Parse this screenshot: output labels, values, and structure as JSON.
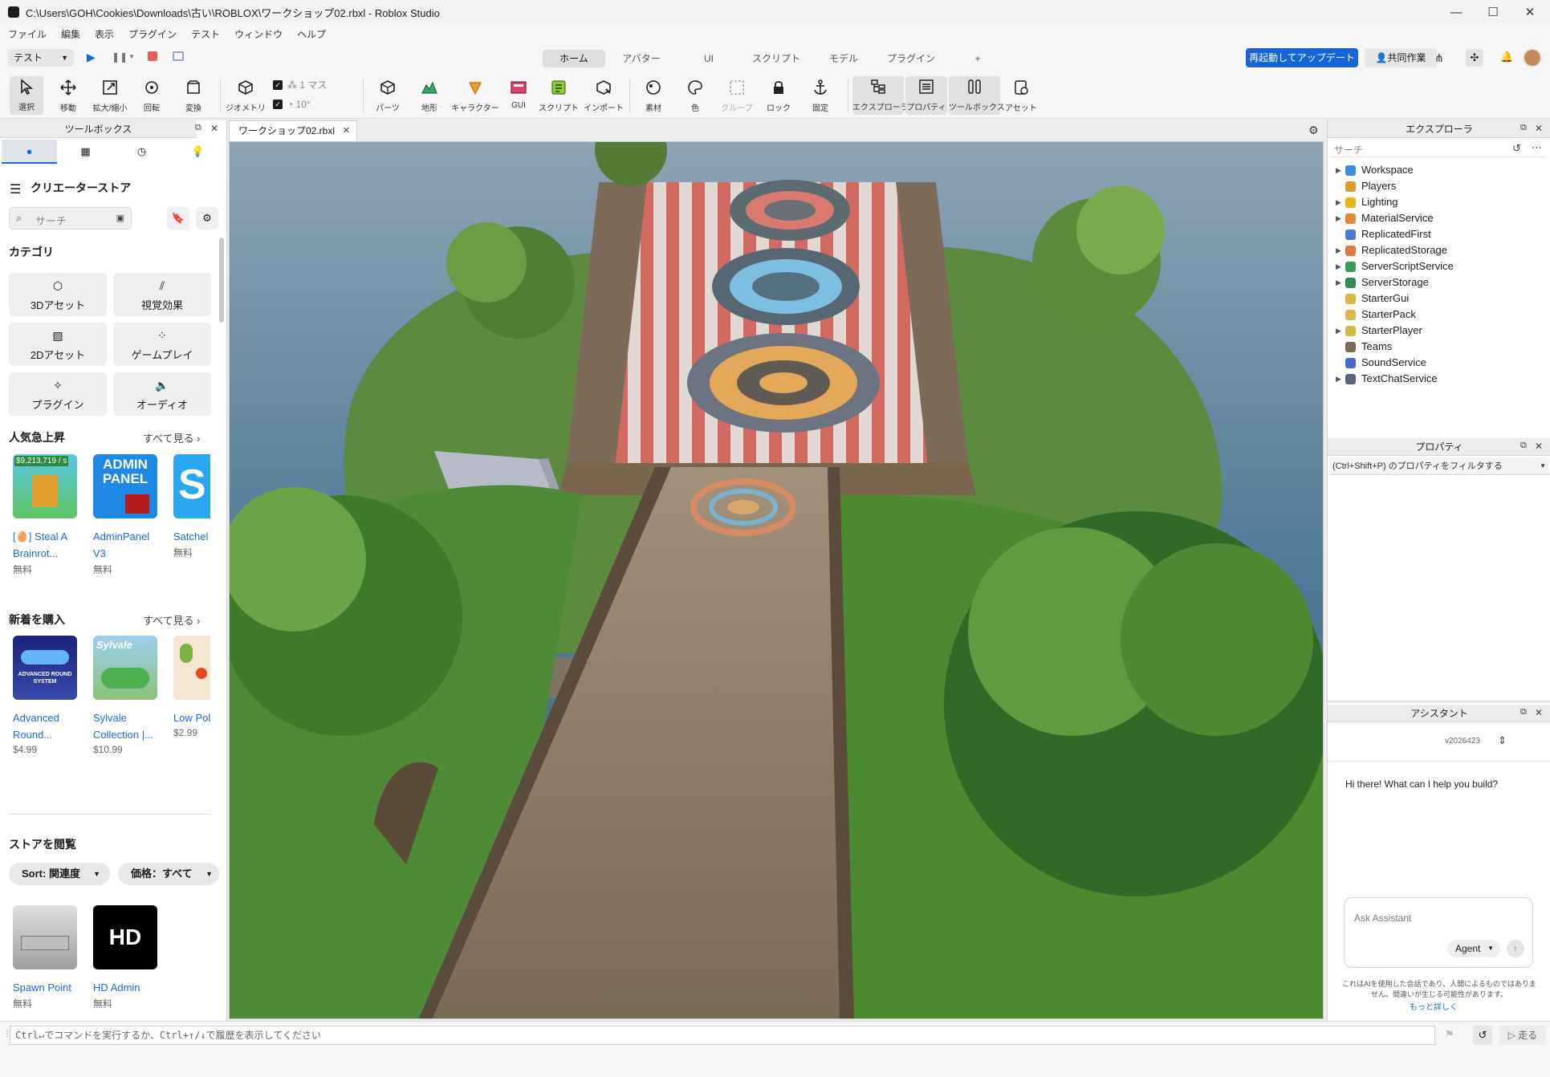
{
  "window": {
    "title": "C:\\Users\\GOH\\Cookies\\Downloads\\古い\\ROBLOX\\ワークショップ02.rbxl - Roblox Studio",
    "minimize": "—",
    "maximize": "☐",
    "close": "✕"
  },
  "menu": [
    "ファイル",
    "編集",
    "表示",
    "プラグイン",
    "テスト",
    "ウィンドウ",
    "ヘルプ"
  ],
  "toolbar_top": {
    "mode_select": "テスト",
    "tabs": [
      "ホーム",
      "アバター",
      "UI",
      "スクリプト",
      "モデル",
      "プラグイン",
      "+"
    ],
    "active_tab": "ホーム",
    "update_button": "再起動してアップデート",
    "collab_button": "共同作業"
  },
  "ribbon": {
    "tools": [
      {
        "label": "選択",
        "icon": "cursor-icon"
      },
      {
        "label": "移動",
        "icon": "move-icon"
      },
      {
        "label": "拡大/縮小",
        "icon": "scale-icon"
      },
      {
        "label": "回転",
        "icon": "rotate-icon"
      },
      {
        "label": "変換",
        "icon": "transform-icon"
      }
    ],
    "geometry_label": "ジオメトリ",
    "snap_move": "1 マス",
    "snap_rotate": "10°",
    "insert": [
      {
        "label": "パーツ",
        "icon": "part-icon"
      },
      {
        "label": "地形",
        "icon": "terrain-icon"
      },
      {
        "label": "キャラクター",
        "icon": "character-icon"
      },
      {
        "label": "GUI",
        "icon": "gui-icon"
      },
      {
        "label": "スクリプト",
        "icon": "script-icon"
      },
      {
        "label": "インポート",
        "icon": "import-icon"
      }
    ],
    "edit": [
      {
        "label": "素材",
        "icon": "material-icon"
      },
      {
        "label": "色",
        "icon": "color-icon"
      },
      {
        "label": "グループ",
        "icon": "group-icon"
      },
      {
        "label": "ロック",
        "icon": "lock-icon"
      },
      {
        "label": "固定",
        "icon": "anchor-icon"
      }
    ],
    "windows": [
      {
        "label": "エクスプローラ",
        "icon": "explorer-icon"
      },
      {
        "label": "プロパティ",
        "icon": "properties-icon"
      },
      {
        "label": "ツールボックス",
        "icon": "toolbox-icon"
      },
      {
        "label": "アセット",
        "icon": "asset-icon"
      }
    ]
  },
  "toolbox": {
    "title": "ツールボックス",
    "store_title": "クリエーターストア",
    "search_placeholder": "サーチ",
    "category_title": "カテゴリ",
    "categories": [
      "3Dアセット",
      "視覚効果",
      "2Dアセット",
      "ゲームプレイ",
      "プラグイン",
      "オーディオ"
    ],
    "trending": {
      "title": "人気急上昇",
      "see_all": "すべて見る ›",
      "items": [
        {
          "name": "[🥚] Steal A Brainrot...",
          "price": "無料",
          "thumb_text": "$9,213,719 / s"
        },
        {
          "name": "AdminPanel V3",
          "price": "無料",
          "thumb_text": "ADMIN PANEL"
        },
        {
          "name": "Satchel",
          "price": "無料",
          "thumb_text": "S"
        }
      ]
    },
    "new": {
      "title": "新着を購入",
      "see_all": "すべて見る ›",
      "items": [
        {
          "name": "Advanced Round...",
          "price": "$4.99",
          "thumb_text": "ADVANCED ROUND SYSTEM"
        },
        {
          "name": "Sylvale Collection |...",
          "price": "$10.99",
          "thumb_text": "Sylvale"
        },
        {
          "name": "Low Poly Nature",
          "price": "$2.99",
          "thumb_text": ""
        }
      ]
    },
    "browse": {
      "title": "ストアを閲覧",
      "sort": "Sort: 関連度",
      "price": "価格：すべて",
      "items": [
        {
          "name": "Spawn Point",
          "price": "無料",
          "thumb_text": ""
        },
        {
          "name": "HD Admin",
          "price": "無料",
          "thumb_text": "HD"
        }
      ]
    }
  },
  "document_tab": "ワークショップ02.rbxl",
  "explorer": {
    "title": "エクスプローラ",
    "search_placeholder": "サーチ",
    "items": [
      {
        "label": "Workspace",
        "expandable": true,
        "icon": "workspace-icon",
        "color": "#3b8fd8"
      },
      {
        "label": "Players",
        "expandable": false,
        "icon": "players-icon",
        "color": "#d8a02a"
      },
      {
        "label": "Lighting",
        "expandable": true,
        "icon": "lighting-icon",
        "color": "#e6b422"
      },
      {
        "label": "MaterialService",
        "expandable": true,
        "icon": "material-service-icon",
        "color": "#e08a3c"
      },
      {
        "label": "ReplicatedFirst",
        "expandable": false,
        "icon": "replicated-first-icon",
        "color": "#4a7bd0"
      },
      {
        "label": "ReplicatedStorage",
        "expandable": true,
        "icon": "replicated-storage-icon",
        "color": "#e07b39"
      },
      {
        "label": "ServerScriptService",
        "expandable": true,
        "icon": "server-script-service-icon",
        "color": "#3a9b5a"
      },
      {
        "label": "ServerStorage",
        "expandable": true,
        "icon": "server-storage-icon",
        "color": "#2e8b57"
      },
      {
        "label": "StarterGui",
        "expandable": false,
        "icon": "starter-gui-icon",
        "color": "#d8b84a"
      },
      {
        "label": "StarterPack",
        "expandable": false,
        "icon": "starter-pack-icon",
        "color": "#d8b84a"
      },
      {
        "label": "StarterPlayer",
        "expandable": true,
        "icon": "starter-player-icon",
        "color": "#d8b84a"
      },
      {
        "label": "Teams",
        "expandable": false,
        "icon": "teams-icon",
        "color": "#7a6a5a"
      },
      {
        "label": "SoundService",
        "expandable": false,
        "icon": "sound-service-icon",
        "color": "#4a6ac8"
      },
      {
        "label": "TextChatService",
        "expandable": true,
        "icon": "text-chat-service-icon",
        "color": "#5a6478"
      }
    ]
  },
  "properties": {
    "title": "プロパティ",
    "filter_placeholder": "(Ctrl+Shift+P) のプロパティをフィルタする"
  },
  "assistant": {
    "title": "アシスタント",
    "version": "v2026423",
    "greeting": "Hi there! What can I help you build?",
    "input_placeholder": "Ask Assistant",
    "mode": "Agent",
    "disclaimer": "これはAIを使用した会話であり、人間によるものではありません。間違いが生じる可能性があります。",
    "learn_more": "もっと詳しく"
  },
  "command_bar": {
    "placeholder": "Ctrl↵でコマンドを実行するか、Ctrl+↑/↓で履歴を表示してください",
    "run": "▷ 走る"
  },
  "colors": {
    "accent": "#1a6adf",
    "update_button": "#1565d8",
    "link": "#1a6adf"
  }
}
